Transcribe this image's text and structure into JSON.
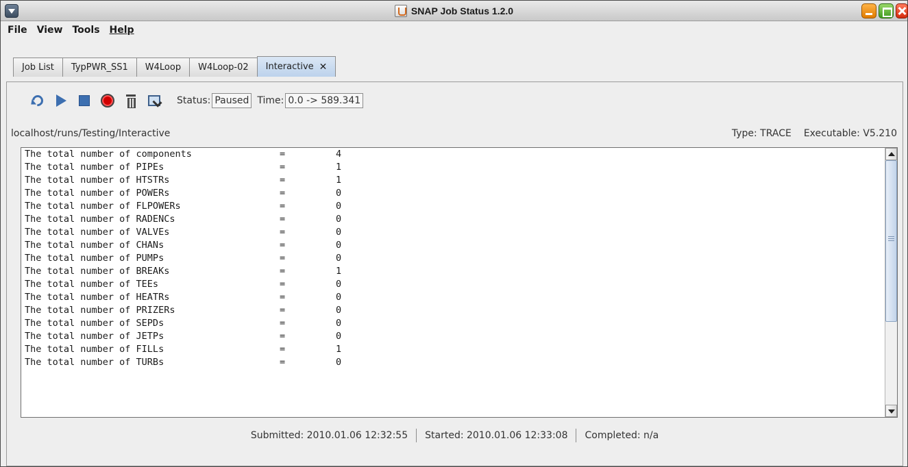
{
  "window": {
    "title": "SNAP Job Status 1.2.0"
  },
  "menu": [
    "File",
    "View",
    "Tools",
    "Help"
  ],
  "tabs": [
    {
      "label": "Job List"
    },
    {
      "label": "TypPWR_SS1"
    },
    {
      "label": "W4Loop"
    },
    {
      "label": "W4Loop-02"
    },
    {
      "label": "Interactive",
      "close": "✕"
    }
  ],
  "toolbar": {
    "icons": [
      "undo-icon",
      "play-icon",
      "stop-icon",
      "record-icon",
      "trash-icon",
      "monitor-icon"
    ],
    "status_label": "Status:",
    "status_value": "Paused",
    "time_label": "Time:",
    "time_value": "0.0 -> 589.341"
  },
  "job": {
    "path": "localhost/runs/Testing/Interactive",
    "type_text": "Type: TRACE",
    "executable_text": "Executable: V5.210"
  },
  "output": {
    "lines": [
      {
        "label": "The total number of components",
        "eq": "=",
        "value": "4"
      },
      {
        "label": "The total number of PIPEs",
        "eq": "=",
        "value": "1"
      },
      {
        "label": "The total number of HTSTRs",
        "eq": "=",
        "value": "1"
      },
      {
        "label": "The total number of POWERs",
        "eq": "=",
        "value": "0"
      },
      {
        "label": "The total number of FLPOWERs",
        "eq": "=",
        "value": "0"
      },
      {
        "label": "The total number of RADENCs",
        "eq": "=",
        "value": "0"
      },
      {
        "label": "The total number of VALVEs",
        "eq": "=",
        "value": "0"
      },
      {
        "label": "The total number of CHANs",
        "eq": "=",
        "value": "0"
      },
      {
        "label": "The total number of PUMPs",
        "eq": "=",
        "value": "0"
      },
      {
        "label": "The total number of BREAKs",
        "eq": "=",
        "value": "1"
      },
      {
        "label": "The total number of TEEs",
        "eq": "=",
        "value": "0"
      },
      {
        "label": "The total number of HEATRs",
        "eq": "=",
        "value": "0"
      },
      {
        "label": "The total number of PRIZERs",
        "eq": "=",
        "value": "0"
      },
      {
        "label": "The total number of SEPDs",
        "eq": "=",
        "value": "0"
      },
      {
        "label": "The total number of JETPs",
        "eq": "=",
        "value": "0"
      },
      {
        "label": "The total number of FILLs",
        "eq": "=",
        "value": "1"
      },
      {
        "label": "The total number of TURBs",
        "eq": "=",
        "value": "0"
      }
    ]
  },
  "footer": {
    "submitted": "Submitted: 2010.01.06 12:32:55",
    "started": "Started: 2010.01.06 12:33:08",
    "completed": "Completed: n/a"
  }
}
